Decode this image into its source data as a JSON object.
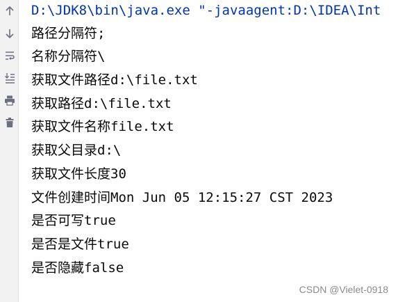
{
  "toolbar": {
    "icons": [
      "arrow-up-icon",
      "arrow-down-icon",
      "soft-wrap-icon",
      "scroll-to-end-icon",
      "print-icon",
      "trash-icon"
    ]
  },
  "console": {
    "command": "D:\\JDK8\\bin\\java.exe \"-javaagent:D:\\IDEA\\Int",
    "lines": [
      "路径分隔符;",
      "名称分隔符\\",
      "获取文件路径d:\\file.txt",
      "获取路径d:\\file.txt",
      "获取文件名称file.txt",
      "获取父目录d:\\",
      "获取文件长度30",
      "文件创建时间Mon Jun 05 12:15:27 CST 2023",
      "是否可写true",
      "是否是文件true",
      "是否隐藏false"
    ]
  },
  "watermark": "CSDN @Vielet-0918",
  "colors": {
    "command": "#0033b3",
    "text": "#080808",
    "toolbar_bg": "#f2f2f2",
    "icon": "#6c707e"
  }
}
